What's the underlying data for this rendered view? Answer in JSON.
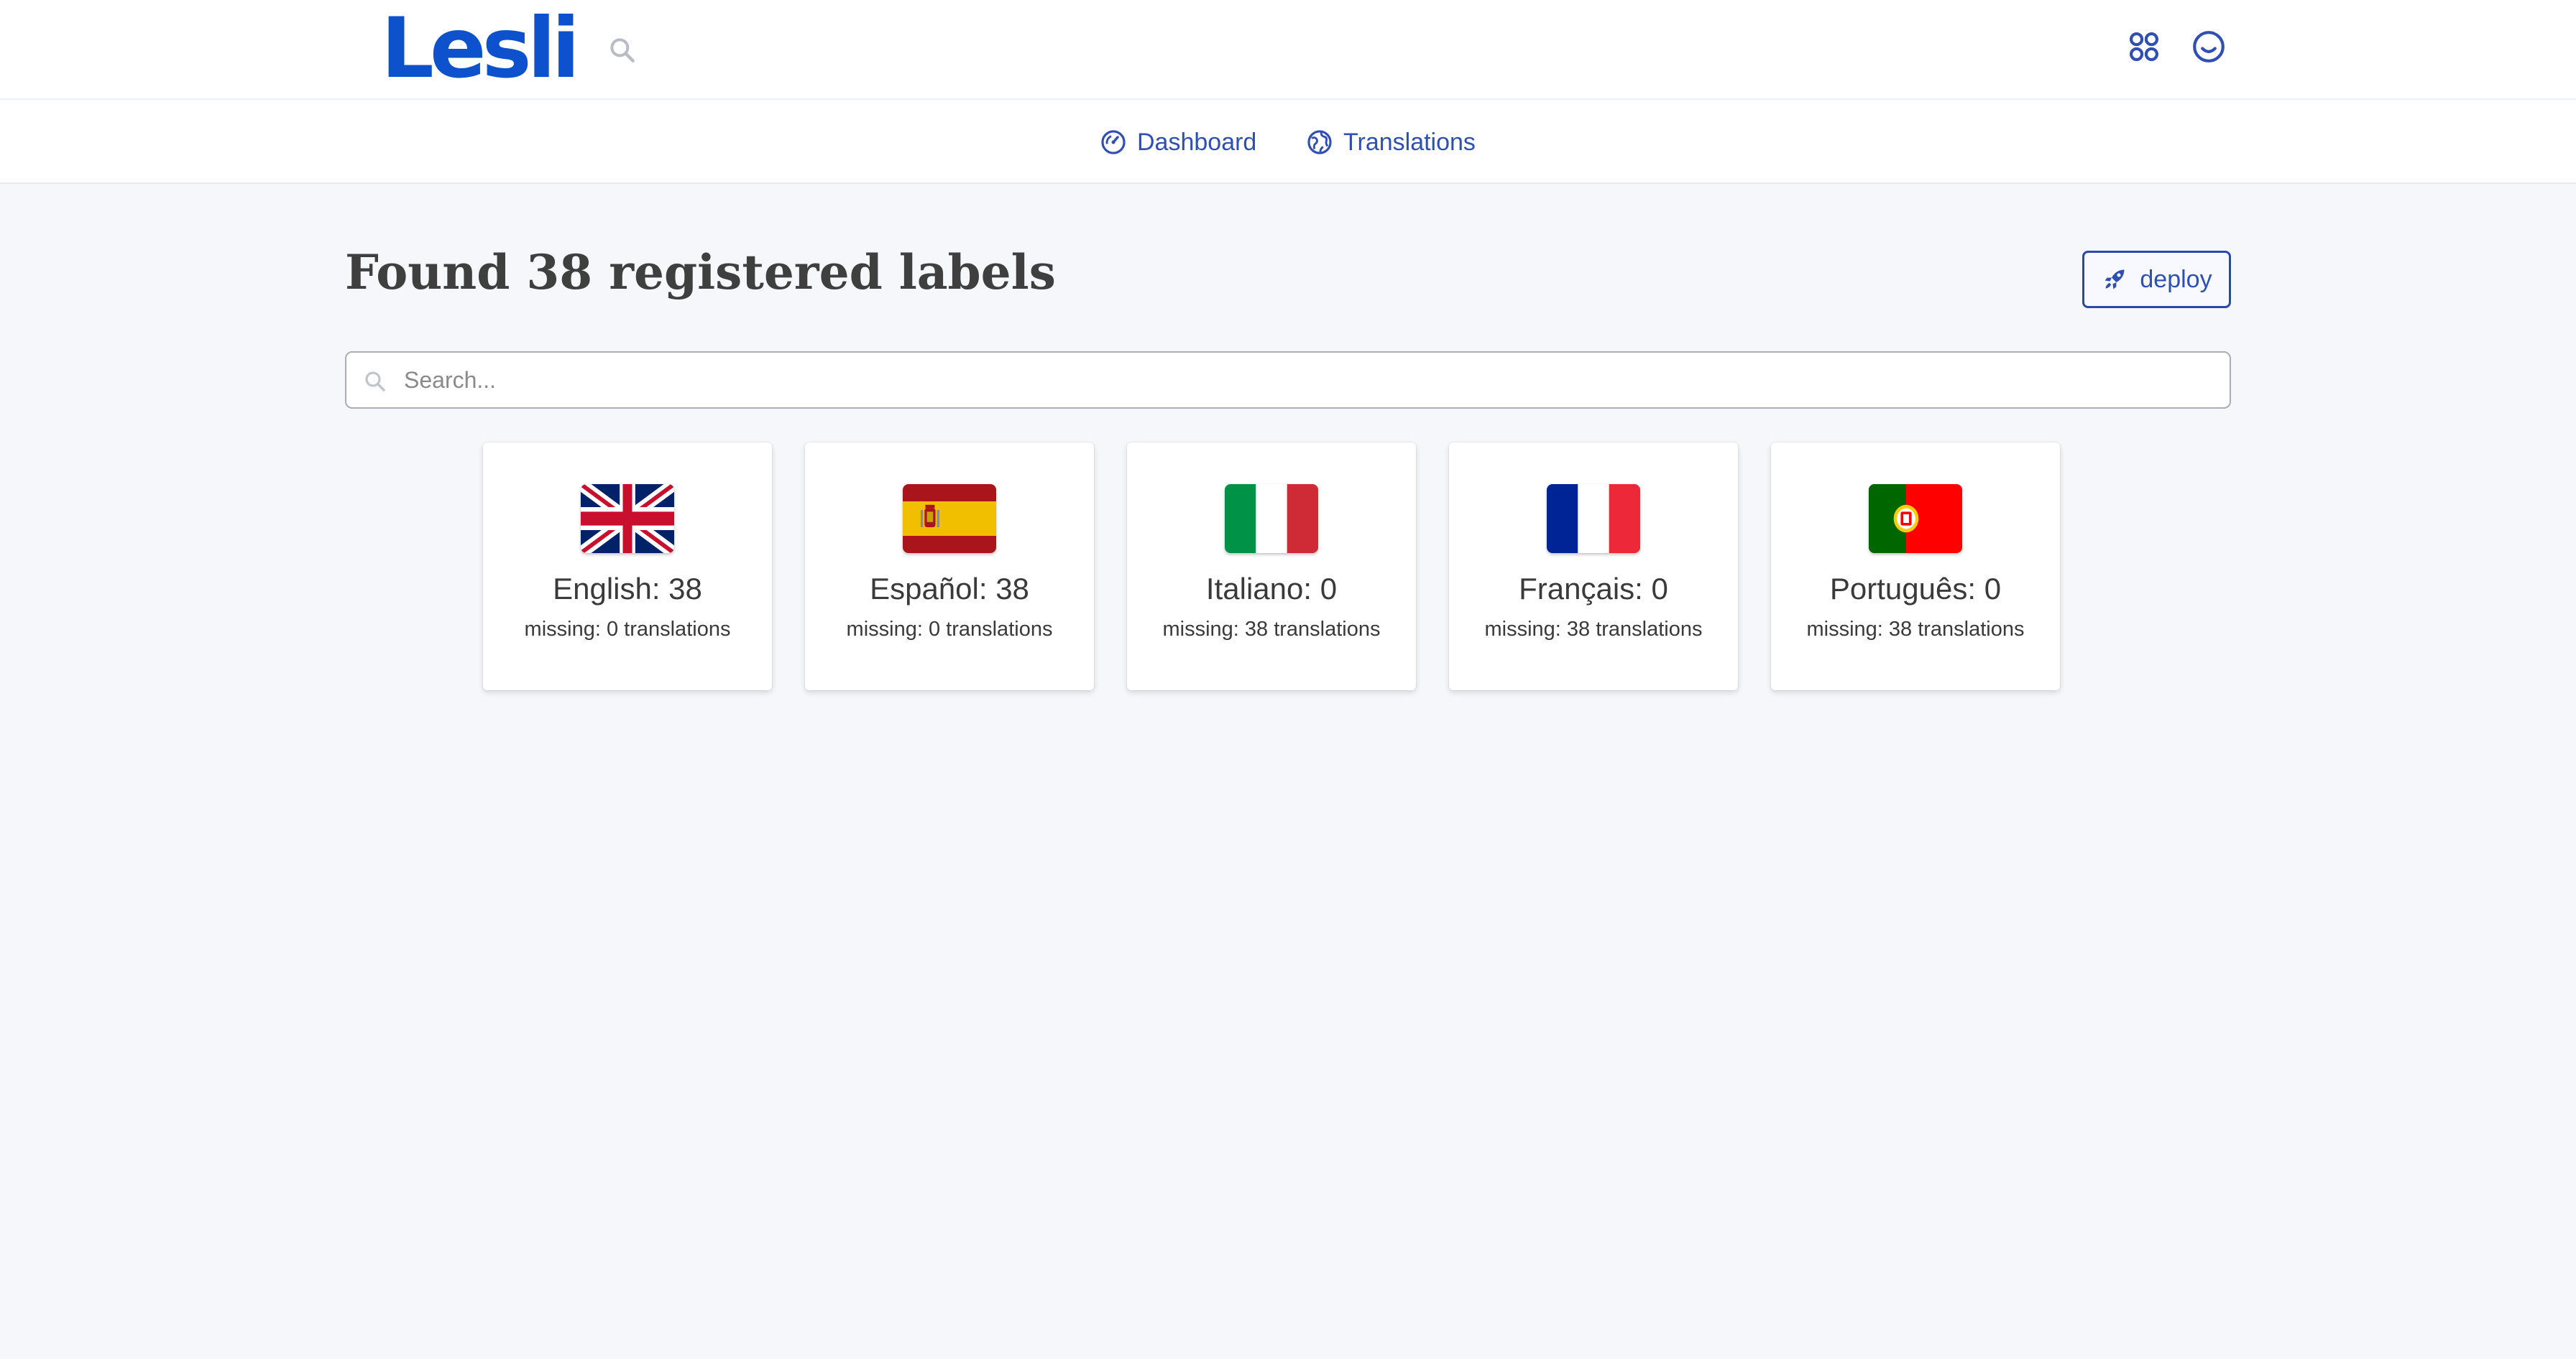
{
  "app": {
    "brand": "Lesli"
  },
  "header": {
    "search_icon": "search-icon",
    "apps_icon": "apps-grid-icon",
    "account_icon": "smiley-icon",
    "accent_color": "#0d52cc"
  },
  "nav": {
    "dashboard": "Dashboard",
    "translations": "Translations"
  },
  "main": {
    "title": "Found 38 registered labels",
    "deploy_label": "deploy",
    "search_placeholder": "Search..."
  },
  "languages": [
    {
      "name": "English: 38",
      "missing": "missing: 0 translations",
      "flag": "uk-flag"
    },
    {
      "name": "Español: 38",
      "missing": "missing: 0 translations",
      "flag": "spain-flag"
    },
    {
      "name": "Italiano: 0",
      "missing": "missing: 38 translations",
      "flag": "italy-flag"
    },
    {
      "name": "Français: 0",
      "missing": "missing: 38 translations",
      "flag": "france-flag"
    },
    {
      "name": "Português: 0",
      "missing": "missing: 38 translations",
      "flag": "portugal-flag"
    }
  ]
}
